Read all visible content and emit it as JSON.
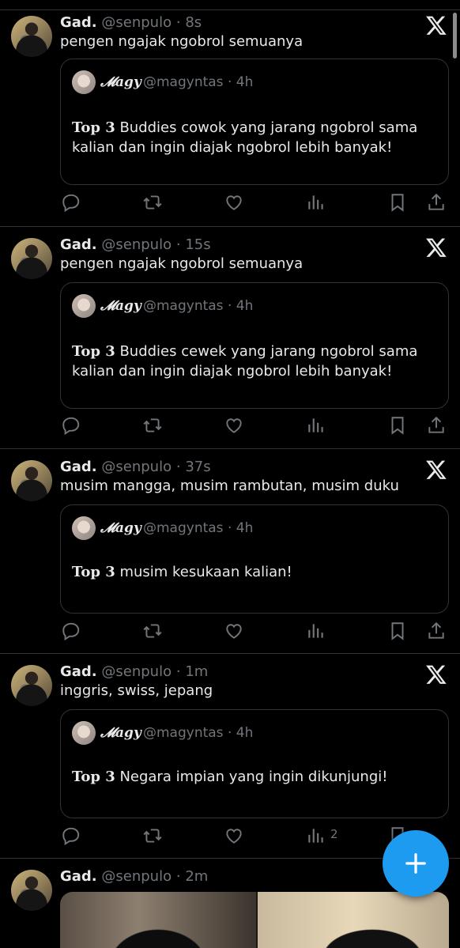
{
  "tweets": [
    {
      "name": "Gad.",
      "handle": "@senpulo",
      "separator": "·",
      "time": "8s",
      "text": "pengen ngajak ngobrol semuanya",
      "quote": {
        "name": "𝓜agy",
        "handle": "@magyntas · 4h",
        "bold": "Top 3",
        "text": " Buddies cowok yang jarang ngobrol sama kalian dan ingin diajak ngobrol lebih banyak!"
      }
    },
    {
      "name": "Gad.",
      "handle": "@senpulo",
      "separator": "·",
      "time": "15s",
      "text": "pengen ngajak ngobrol semuanya",
      "quote": {
        "name": "𝓜agy",
        "handle": "@magyntas · 4h",
        "bold": "Top 3",
        "text": " Buddies cewek yang jarang ngobrol sama kalian dan ingin diajak ngobrol lebih banyak!"
      }
    },
    {
      "name": "Gad.",
      "handle": "@senpulo",
      "separator": "·",
      "time": "37s",
      "text": "musim mangga, musim rambutan, musim duku",
      "quote": {
        "name": "𝓜agy",
        "handle": "@magyntas · 4h",
        "bold": "Top 3",
        "text": " musim kesukaan kalian!"
      }
    },
    {
      "name": "Gad.",
      "handle": "@senpulo",
      "separator": "·",
      "time": "1m",
      "text": "inggris, swiss, jepang",
      "quote": {
        "name": "𝓜agy",
        "handle": "@magyntas · 4h",
        "bold": "Top 3",
        "text": " Negara impian yang ingin dikunjungi!"
      },
      "views_count": "2"
    },
    {
      "name": "Gad.",
      "handle": "@senpulo",
      "separator": "·",
      "time": "2m"
    }
  ],
  "icons": {
    "reply": "reply-icon",
    "retweet": "retweet-icon",
    "like": "heart-icon",
    "views": "views-icon",
    "bookmark": "bookmark-icon",
    "share": "share-icon",
    "x_logo": "x-logo-icon",
    "compose": "plus-icon"
  },
  "colors": {
    "background": "#000000",
    "accent": "#1d9bf0",
    "secondary_text": "#71767b",
    "border": "#2f3336"
  }
}
